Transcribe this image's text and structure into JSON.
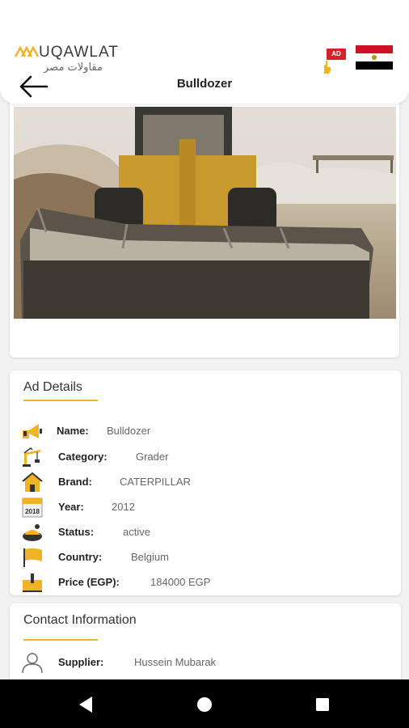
{
  "header": {
    "logo_text": "UQAWLAT",
    "logo_arabic": "مقاولات مصر",
    "ad_badge": "AD",
    "title": "Bulldozer"
  },
  "colors": {
    "accent": "#f0b323",
    "flag_red": "#ce1126",
    "flag_white": "#ffffff",
    "flag_black": "#000000"
  },
  "details": {
    "title": "Ad Details",
    "rows": [
      {
        "icon": "megaphone-icon",
        "label": "Name:",
        "value": "Bulldozer"
      },
      {
        "icon": "crane-icon",
        "label": "Category:",
        "value": "Grader"
      },
      {
        "icon": "home-icon",
        "label": "Brand:",
        "value": "CATERPILLAR"
      },
      {
        "icon": "calendar-icon",
        "label": "Year:",
        "value": "2012",
        "calendar_text": "2018"
      },
      {
        "icon": "status-icon",
        "label": "Status:",
        "value": "active"
      },
      {
        "icon": "flag-icon",
        "label": "Country:",
        "value": "Belgium"
      },
      {
        "icon": "price-icon",
        "label": "Price (EGP):",
        "value": "184000 EGP"
      }
    ]
  },
  "contact": {
    "title": "Contact Information",
    "rows": [
      {
        "icon": "user-icon",
        "label": "Supplier:",
        "value": "Hussein Mubarak"
      }
    ]
  },
  "navbar": {
    "back": "back-triangle-icon",
    "home": "home-circle-icon",
    "recents": "recents-square-icon"
  }
}
